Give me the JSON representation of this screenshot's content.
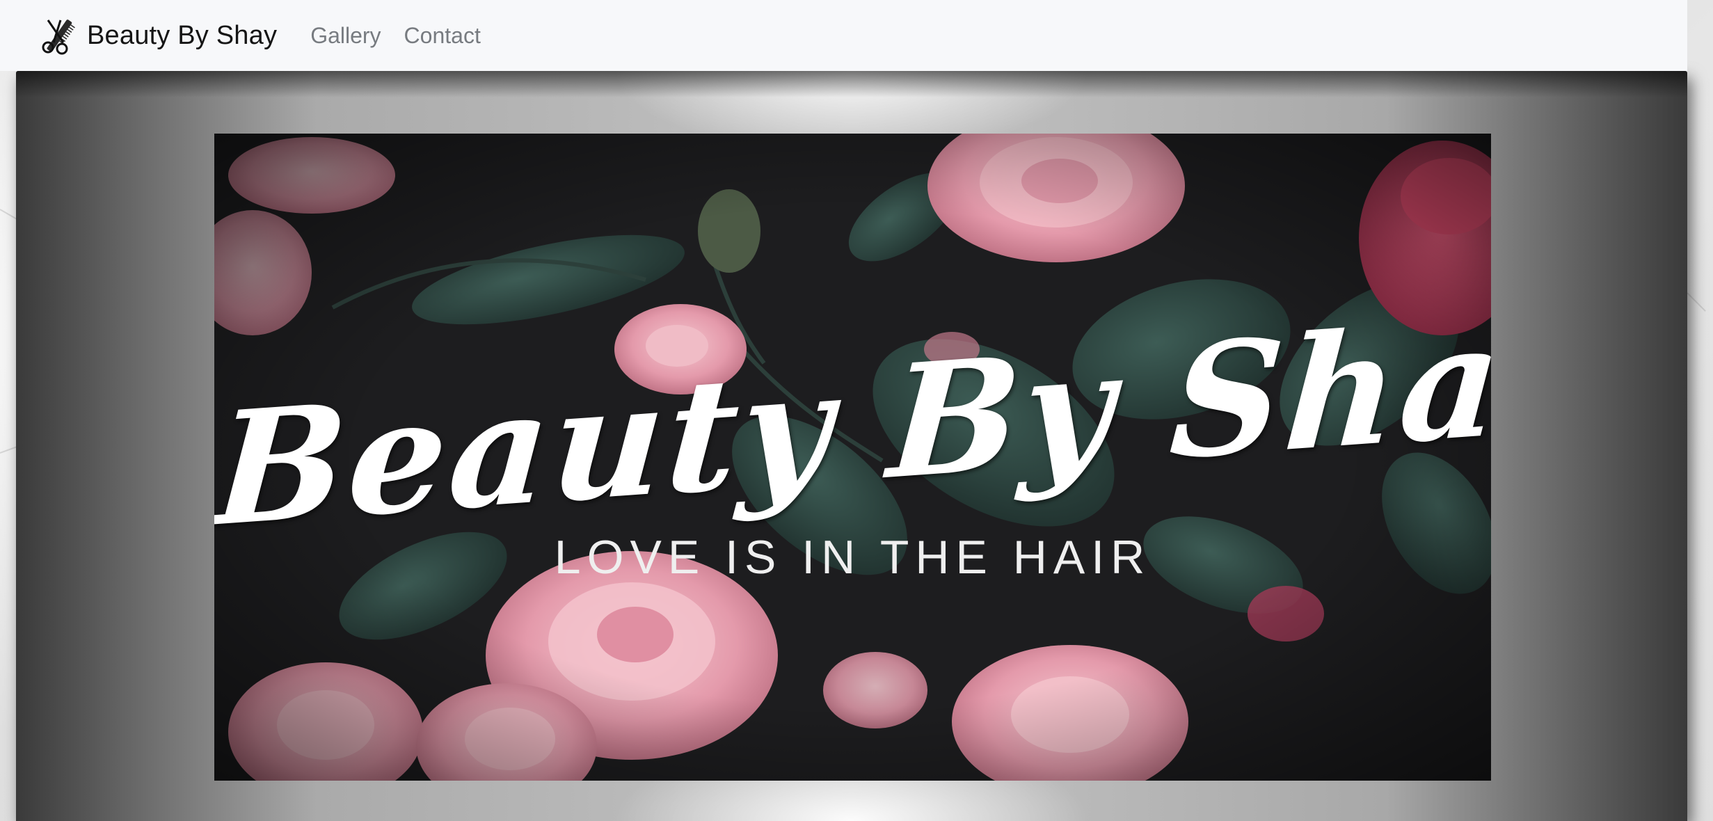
{
  "navbar": {
    "brand": "Beauty By Shay",
    "brand_icon": "scissors-comb-icon",
    "links": [
      {
        "label": "Gallery"
      },
      {
        "label": "Contact"
      }
    ]
  },
  "hero": {
    "banner_title": "Beauty By Shay",
    "banner_tagline": "LOVE IS IN THE HAIR"
  },
  "colors": {
    "navbar_bg": "#f7f8fa",
    "nav_link": "#777b80",
    "banner_bg": "#1c1c1e",
    "flower_pink": "#e7a3b3",
    "leaf_green": "#2f4a44"
  }
}
